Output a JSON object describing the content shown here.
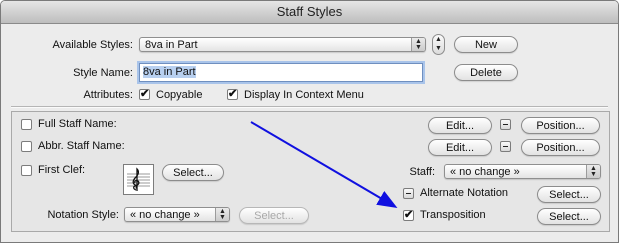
{
  "window": {
    "title": "Staff Styles"
  },
  "top": {
    "available_styles_label": "Available Styles:",
    "available_styles_value": "8va in Part",
    "new_button": "New",
    "style_name_label": "Style Name:",
    "style_name_value": "8va in Part",
    "delete_button": "Delete",
    "attributes_label": "Attributes:",
    "copyable_label": "Copyable",
    "copyable_checked": true,
    "display_context_label": "Display In Context Menu",
    "display_context_checked": true
  },
  "panel": {
    "full_staff_name_label": "Full Staff Name:",
    "abbr_staff_name_label": "Abbr. Staff Name:",
    "edit_button": "Edit...",
    "position_button": "Position...",
    "first_clef_label": "First Clef:",
    "select_button": "Select...",
    "staff_label": "Staff:",
    "staff_value": "« no change »",
    "alternate_notation_label": "Alternate Notation",
    "transposition_label": "Transposition",
    "transposition_checked": true,
    "notation_style_label": "Notation Style:",
    "notation_style_value": "« no change »",
    "notation_select_button": "Select...",
    "clef_icon": "treble-clef-icon"
  },
  "icons": {
    "popup_arrows": "up-down-arrows-icon",
    "checkmark": "✔",
    "mixed": "–"
  },
  "colors": {
    "annotation_arrow": "#1010e0",
    "focus_ring": "#a9c4ea"
  }
}
